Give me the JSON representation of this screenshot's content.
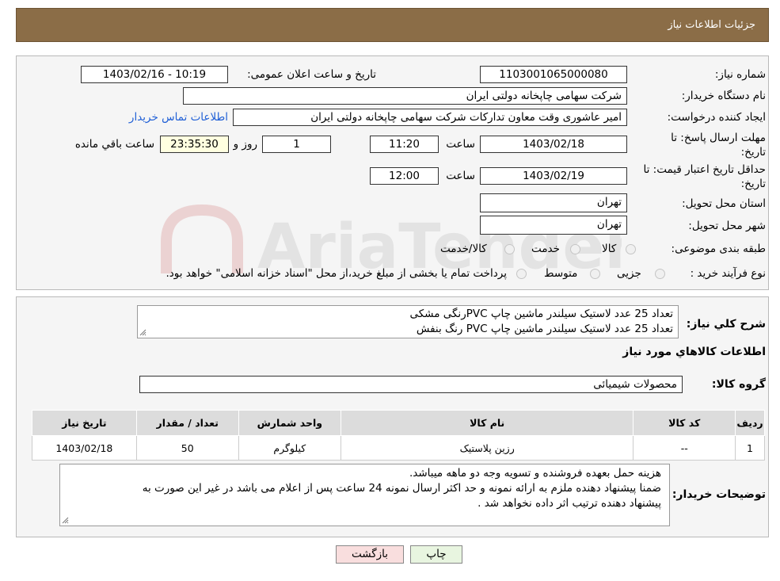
{
  "header": {
    "title": "جزئیات اطلاعات نیاز"
  },
  "fields": {
    "need_number_label": "شماره نیاز:",
    "need_number": "1103001065000080",
    "announce_label": "تاریخ و ساعت اعلان عمومی:",
    "announce_value": "1403/02/16 - 10:19",
    "buyer_org_label": "نام دستگاه خریدار:",
    "buyer_org": "شرکت سهامی چاپخانه دولتی ایران",
    "requester_label": "ایجاد کننده درخواست:",
    "requester": "امیر عاشوری وقت معاون تدارکات شرکت سهامی چاپخانه دولتی ایران",
    "contact_link": "اطلاعات تماس خریدار",
    "reply_deadline_label_1": "مهلت ارسال پاسخ: تا",
    "reply_deadline_label_2": "تاریخ:",
    "reply_date": "1403/02/18",
    "time_label": "ساعت",
    "reply_time": "11:20",
    "days_value": "1",
    "days_label": "روز و",
    "remaining_value": "23:35:30",
    "remaining_label": "ساعت باقي مانده",
    "price_valid_label_1": "حداقل تاریخ اعتبار قیمت: تا",
    "price_valid_label_2": "تاریخ:",
    "price_valid_date": "1403/02/19",
    "price_valid_time": "12:00",
    "province_label": "استان محل تحویل:",
    "province": "تهران",
    "city_label": "شهر محل تحویل:",
    "city": "تهران",
    "category_label": "طبقه بندی موضوعی:",
    "category_options": [
      "کالا",
      "خدمت",
      "کالا/خدمت"
    ],
    "purchase_type_label": "نوع فرآیند خرید :",
    "purchase_options": [
      "جزیی",
      "متوسط"
    ],
    "purchase_note": "پرداخت تمام یا بخشی از مبلغ خرید،از محل \"اسناد خزانه اسلامی\" خواهد بود."
  },
  "details": {
    "summary_label": "شرح کلي نياز:",
    "summary_lines": [
      "تعداد 25 عدد لاستیک سیلندر ماشین چاپ PVCرنگی مشکی",
      "تعداد 25 عدد لاستیک سیلندر ماشین چاپ PVC رنگ بنفش"
    ],
    "goods_info_title": "اطلاعات کالاهاي مورد نياز",
    "goods_group_label": "گروه کالا:",
    "goods_group": "محصولات شیمیائی",
    "table": {
      "headers": [
        "رديف",
        "کد کالا",
        "نام کالا",
        "واحد شمارش",
        "تعداد / مقدار",
        "تاریخ نیاز"
      ],
      "rows": [
        [
          "1",
          "--",
          "رزین پلاستیک",
          "کیلوگرم",
          "50",
          "1403/02/18"
        ]
      ]
    },
    "buyer_notes_label": "توضیحات خریدار:",
    "buyer_notes_lines": [
      "هزینه حمل بعهده فروشنده و تسویه وجه دو ماهه  میباشد.",
      "ضمنا پیشنهاد دهنده ملزم به ارائه نمونه و  حد اکثر ارسال نمونه 24 ساعت پس از اعلام می باشد در غیر این صورت به",
      "پیشنهاد دهنده ترتیب  اثر داده نخواهد شد ."
    ]
  },
  "buttons": {
    "print": "چاپ",
    "back": "بازگشت"
  },
  "watermark": {
    "text": "AriaTender.neT"
  },
  "colors": {
    "header_bg": "#8b6d47",
    "link": "#1f5fd6",
    "remaining_bg": "#ffffe0",
    "back_btn_bg": "#f9dede"
  }
}
